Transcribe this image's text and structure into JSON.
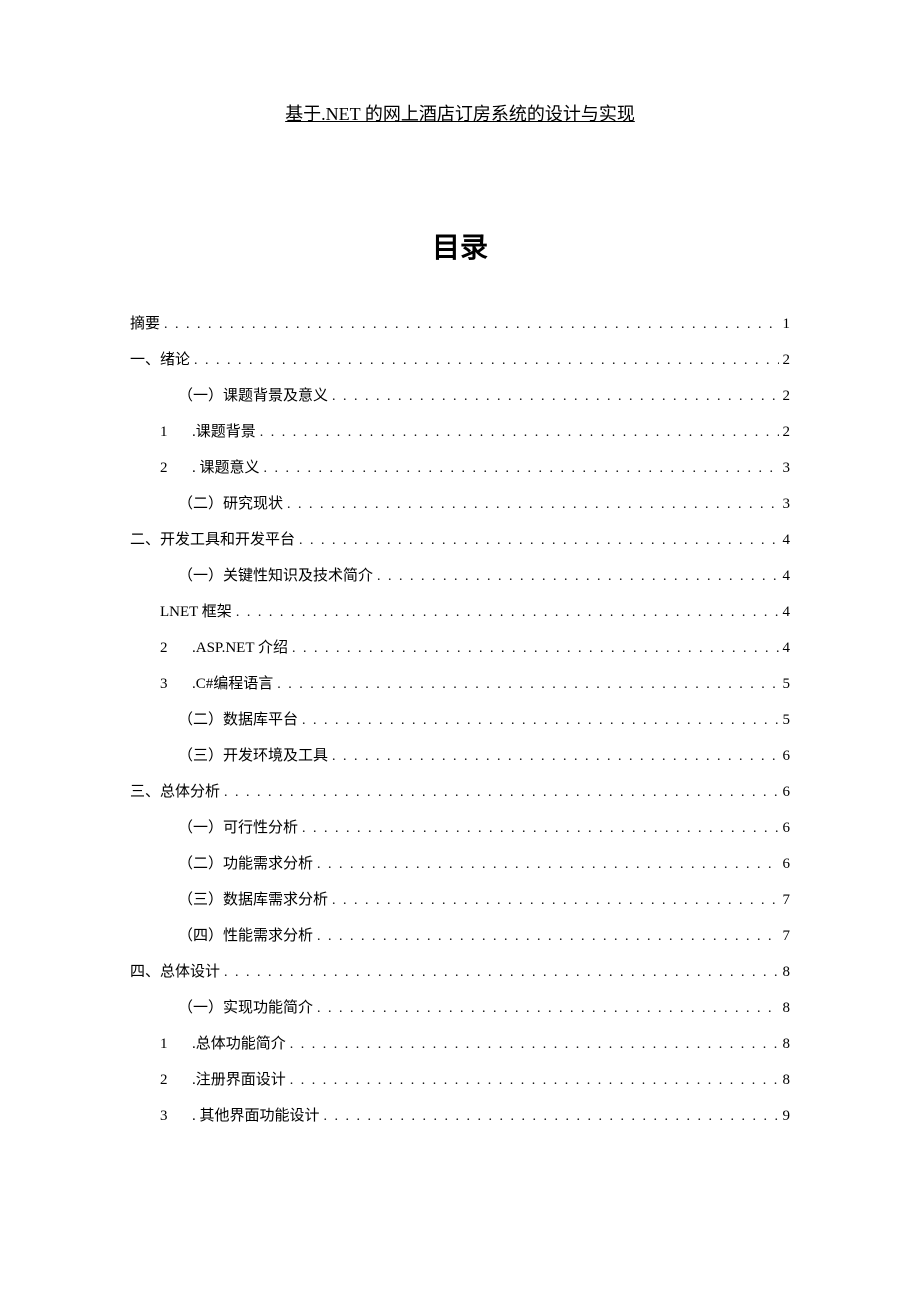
{
  "title": "基于.NET 的网上酒店订房系统的设计与实现",
  "toc_heading": "目录",
  "entries": [
    {
      "level": "1",
      "label": "摘要",
      "page": "1"
    },
    {
      "level": "1",
      "label": "一、绪论",
      "page": "2"
    },
    {
      "level": "2",
      "label": "（一）课题背景及意义",
      "page": "2"
    },
    {
      "level": "2-num",
      "num": "1",
      "label": ".课题背景",
      "page": "2"
    },
    {
      "level": "2-num",
      "num": "2",
      "label": ". 课题意义",
      "page": "3"
    },
    {
      "level": "2",
      "label": "（二）研究现状",
      "page": "3"
    },
    {
      "level": "1",
      "label": "二、开发工具和开发平台",
      "page": "4"
    },
    {
      "level": "2",
      "label": "（一）关键性知识及技术简介",
      "page": "4"
    },
    {
      "level": "2-num",
      "num": "",
      "label": "LNET 框架",
      "page": "4"
    },
    {
      "level": "2-num",
      "num": "2",
      "label": ".ASP.NET 介绍",
      "page": "4"
    },
    {
      "level": "2-num",
      "num": "3",
      "label": ".C#编程语言",
      "page": "5"
    },
    {
      "level": "2",
      "label": "（二）数据库平台",
      "page": "5"
    },
    {
      "level": "2",
      "label": "（三）开发环境及工具",
      "page": "6"
    },
    {
      "level": "1",
      "label": "三、总体分析",
      "page": "6"
    },
    {
      "level": "2",
      "label": "（一）可行性分析",
      "page": "6"
    },
    {
      "level": "2",
      "label": "（二）功能需求分析",
      "page": "6"
    },
    {
      "level": "2",
      "label": "（三）数据库需求分析",
      "page": "7"
    },
    {
      "level": "2",
      "label": "（四）性能需求分析",
      "page": "7"
    },
    {
      "level": "1",
      "label": "四、总体设计",
      "page": "8"
    },
    {
      "level": "2",
      "label": "（一）实现功能简介",
      "page": "8"
    },
    {
      "level": "2-num",
      "num": "1",
      "label": ".总体功能简介",
      "page": "8"
    },
    {
      "level": "2-num",
      "num": "2",
      "label": ".注册界面设计",
      "page": "8"
    },
    {
      "level": "2-num",
      "num": "3",
      "label": ". 其他界面功能设计",
      "page": "9"
    }
  ]
}
